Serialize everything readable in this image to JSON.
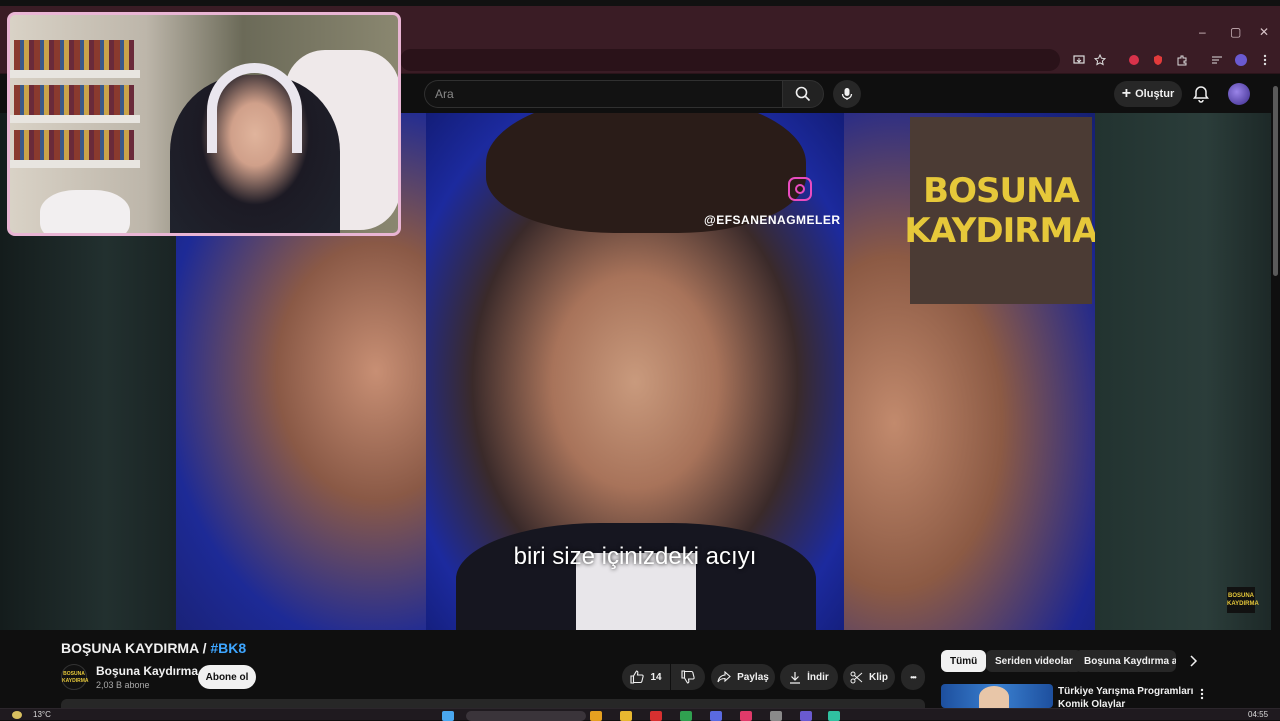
{
  "browser": {
    "window_controls": [
      "–",
      "▢",
      "✕"
    ]
  },
  "youtube": {
    "search": {
      "placeholder": "Ara"
    },
    "create_label": "Oluştur"
  },
  "player": {
    "overlay_handle": "@EFSANENAGMELER",
    "subtitle": "biri size içinizdeki acıyı",
    "logo_lines": [
      "BOSUNA",
      "KAYDIRMA"
    ],
    "watermark_lines": [
      "BOSUNA",
      "KAYDIRMA"
    ]
  },
  "video": {
    "title": "BOŞUNA KAYDIRMA /",
    "hashtag": "#BK8",
    "channel": {
      "name": "Boşuna Kaydırma",
      "subscribers": "2,03 B abone",
      "subscribe_label": "Abone ol",
      "avatar_lines": [
        "BOSUNA",
        "KAYDIRMA"
      ]
    },
    "actions": {
      "likes": "14",
      "share": "Paylaş",
      "download": "İndir",
      "clip": "Klip",
      "more": "•••"
    }
  },
  "sidebar": {
    "chips": [
      "Tümü",
      "Seriden videolar",
      "Boşuna Kaydırma adl"
    ],
    "related": {
      "title": "Türkiye Yarışma Programları Komik Olaylar"
    }
  },
  "taskbar": {
    "weather": "13°C",
    "clock": "04:55"
  },
  "colors": {
    "accent_link": "#3ea6ff",
    "browser_chrome": "#3a1c25",
    "logo_yellow": "#e6c83a",
    "cam_border": "#e9b5d4"
  }
}
